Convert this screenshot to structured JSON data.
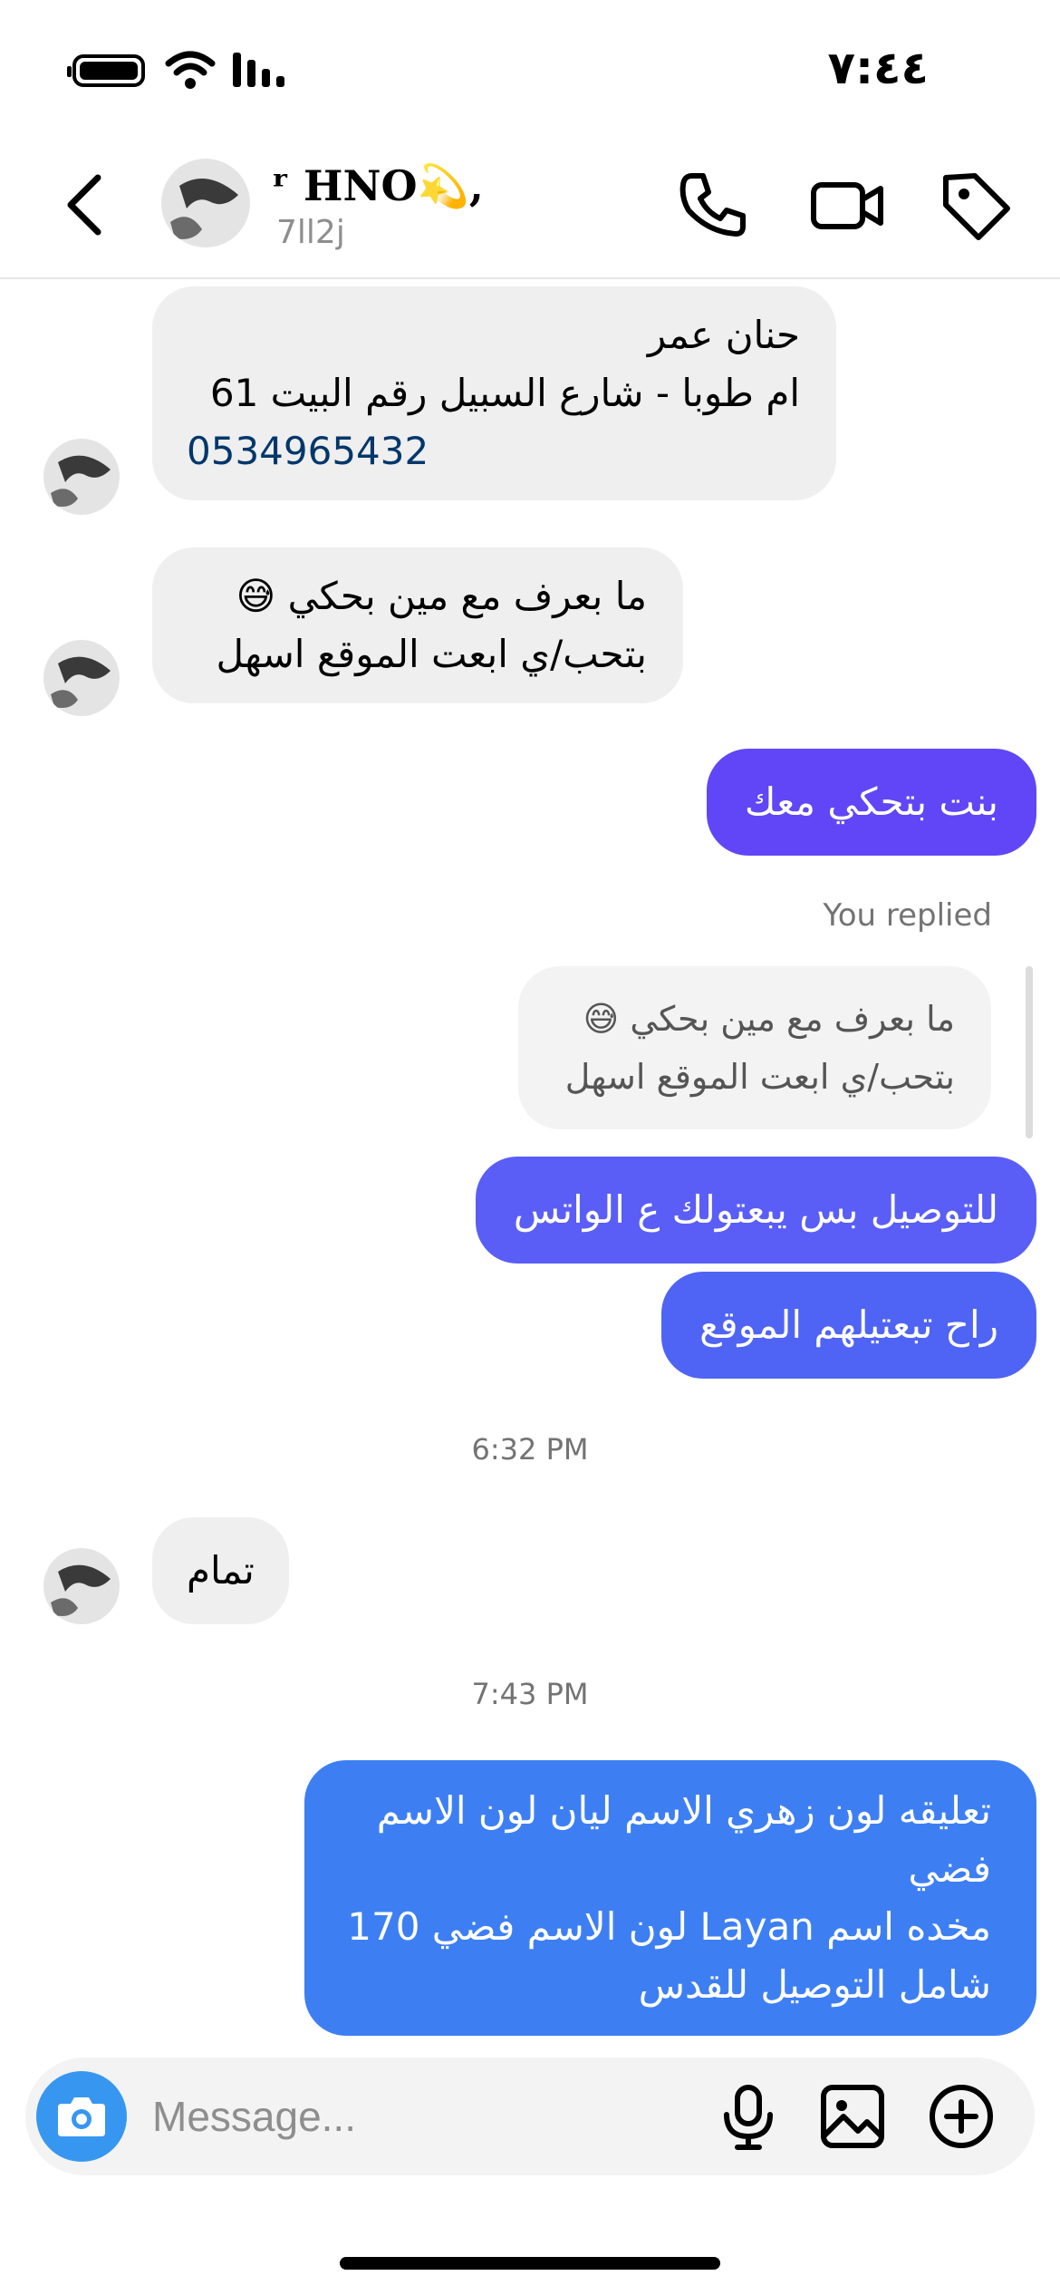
{
  "status_bar": {
    "time": "٧:٤٤",
    "battery_icon": "battery-icon",
    "wifi_icon": "wifi-icon",
    "signal_icon": "signal-icon"
  },
  "header": {
    "title": "ʳ HNO💫,",
    "subtitle": "7ll2j",
    "icons": [
      "back-chevron-icon",
      "phone-icon",
      "video-camera-icon",
      "tag-icon"
    ]
  },
  "messages": {
    "m1": {
      "line1": "حنان عمر",
      "line2": "ام طوبا - شارع السبيل رقم البيت 61",
      "phone": "0534965432"
    },
    "m2": {
      "line1": "ما بعرف مع مين بحكي",
      "line2": "بتحب/ي ابعت الموقع اسهل",
      "emoji": "😅"
    },
    "m3": {
      "text": "بنت بتحكي معك",
      "color": "#6046f6"
    },
    "reply_label": "You replied",
    "reply_quote": {
      "line1": "ما بعرف مع مين بحكي",
      "line2": "بتحب/ي ابعت الموقع اسهل",
      "emoji": "😅"
    },
    "m4": {
      "text": "للتوصيل بس يبعتولك ع الواتس",
      "color": "#5a5ef6"
    },
    "m5": {
      "text": "راح تبعتيلهم الموقع",
      "color": "#4f64f4"
    },
    "ts1": "6:32 PM",
    "m6": {
      "text": "تمام"
    },
    "ts2": "7:43 PM",
    "m7": {
      "line1": "تعليقه لون زهري الاسم ليان لون الاسم",
      "line2": "فضي",
      "line3": "مخده اسم Layan لون الاسم فضي 170",
      "line4": "شامل التوصيل للقدس",
      "color": "#3d7ff3"
    }
  },
  "composer": {
    "placeholder": "Message...",
    "icons": [
      "camera-icon",
      "microphone-icon",
      "gallery-icon",
      "plus-circle-icon"
    ],
    "camera_color": "#3797f0"
  }
}
